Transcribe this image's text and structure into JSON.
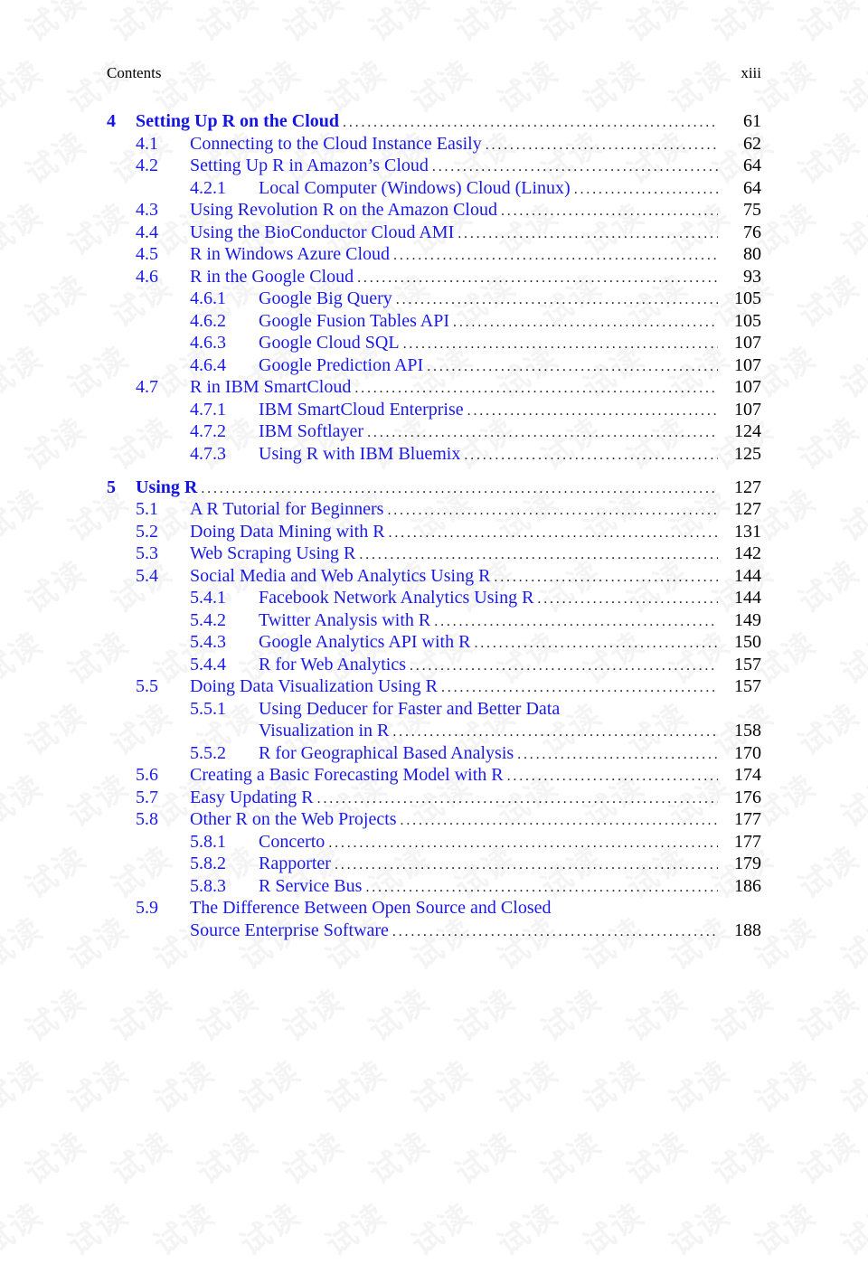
{
  "header": {
    "left": "Contents",
    "right": "xiii"
  },
  "watermark": {
    "text": "试读"
  },
  "colors": {
    "link": "#1a1ae6",
    "text": "#000000"
  },
  "toc": [
    {
      "level": 0,
      "num": "4",
      "title": "Setting Up R on the Cloud",
      "page": "61"
    },
    {
      "level": 1,
      "num": "4.1",
      "title": "Connecting to the Cloud Instance Easily",
      "page": "62"
    },
    {
      "level": 1,
      "num": "4.2",
      "title": "Setting Up R in Amazon’s Cloud",
      "page": "64"
    },
    {
      "level": 2,
      "num": "4.2.1",
      "title": "Local Computer (Windows) Cloud (Linux)",
      "page": "64"
    },
    {
      "level": 1,
      "num": "4.3",
      "title": "Using Revolution R on the Amazon Cloud",
      "page": "75"
    },
    {
      "level": 1,
      "num": "4.4",
      "title": "Using the BioConductor Cloud AMI",
      "page": "76"
    },
    {
      "level": 1,
      "num": "4.5",
      "title": "R in Windows Azure Cloud",
      "page": "80"
    },
    {
      "level": 1,
      "num": "4.6",
      "title": "R in the Google Cloud",
      "page": "93"
    },
    {
      "level": 2,
      "num": "4.6.1",
      "title": "Google Big Query",
      "page": "105"
    },
    {
      "level": 2,
      "num": "4.6.2",
      "title": "Google Fusion Tables API",
      "page": "105"
    },
    {
      "level": 2,
      "num": "4.6.3",
      "title": "Google Cloud SQL",
      "page": "107"
    },
    {
      "level": 2,
      "num": "4.6.4",
      "title": "Google Prediction API",
      "page": "107"
    },
    {
      "level": 1,
      "num": "4.7",
      "title": "R in IBM SmartCloud",
      "page": "107"
    },
    {
      "level": 2,
      "num": "4.7.1",
      "title": "IBM SmartCloud Enterprise",
      "page": "107"
    },
    {
      "level": 2,
      "num": "4.7.2",
      "title": "IBM Softlayer",
      "page": "124"
    },
    {
      "level": 2,
      "num": "4.7.3",
      "title": "Using R with IBM Bluemix",
      "page": "125"
    },
    {
      "level": 0,
      "num": "5",
      "title": "Using R",
      "page": "127",
      "gap": true
    },
    {
      "level": 1,
      "num": "5.1",
      "title": "A R Tutorial for Beginners",
      "page": "127"
    },
    {
      "level": 1,
      "num": "5.2",
      "title": "Doing Data Mining with R",
      "page": "131"
    },
    {
      "level": 1,
      "num": "5.3",
      "title": "Web Scraping Using R",
      "page": "142"
    },
    {
      "level": 1,
      "num": "5.4",
      "title": "Social Media and Web Analytics Using R",
      "page": "144"
    },
    {
      "level": 2,
      "num": "5.4.1",
      "title": "Facebook Network Analytics Using R",
      "page": "144"
    },
    {
      "level": 2,
      "num": "5.4.2",
      "title": "Twitter Analysis with R",
      "page": "149"
    },
    {
      "level": 2,
      "num": "5.4.3",
      "title": "Google Analytics API with R",
      "page": "150"
    },
    {
      "level": 2,
      "num": "5.4.4",
      "title": "R for Web Analytics",
      "page": "157"
    },
    {
      "level": 1,
      "num": "5.5",
      "title": "Doing Data Visualization Using R",
      "page": "157"
    },
    {
      "level": 2,
      "num": "5.5.1",
      "title": "Using Deducer for Faster and Better Data",
      "page": "",
      "cont": "Visualization in R",
      "cont_page": "158"
    },
    {
      "level": 2,
      "num": "5.5.2",
      "title": "R for Geographical Based Analysis",
      "page": "170"
    },
    {
      "level": 1,
      "num": "5.6",
      "title": "Creating a Basic Forecasting Model with R",
      "page": "174"
    },
    {
      "level": 1,
      "num": "5.7",
      "title": "Easy Updating R",
      "page": "176"
    },
    {
      "level": 1,
      "num": "5.8",
      "title": "Other R on the Web Projects",
      "page": "177"
    },
    {
      "level": 2,
      "num": "5.8.1",
      "title": "Concerto",
      "page": "177"
    },
    {
      "level": 2,
      "num": "5.8.2",
      "title": "Rapporter",
      "page": "179"
    },
    {
      "level": 2,
      "num": "5.8.3",
      "title": "R Service Bus",
      "page": "186"
    },
    {
      "level": 1,
      "num": "5.9",
      "title": "The Difference Between Open Source and Closed",
      "page": "",
      "cont": "Source Enterprise Software",
      "cont_page": "188"
    }
  ]
}
